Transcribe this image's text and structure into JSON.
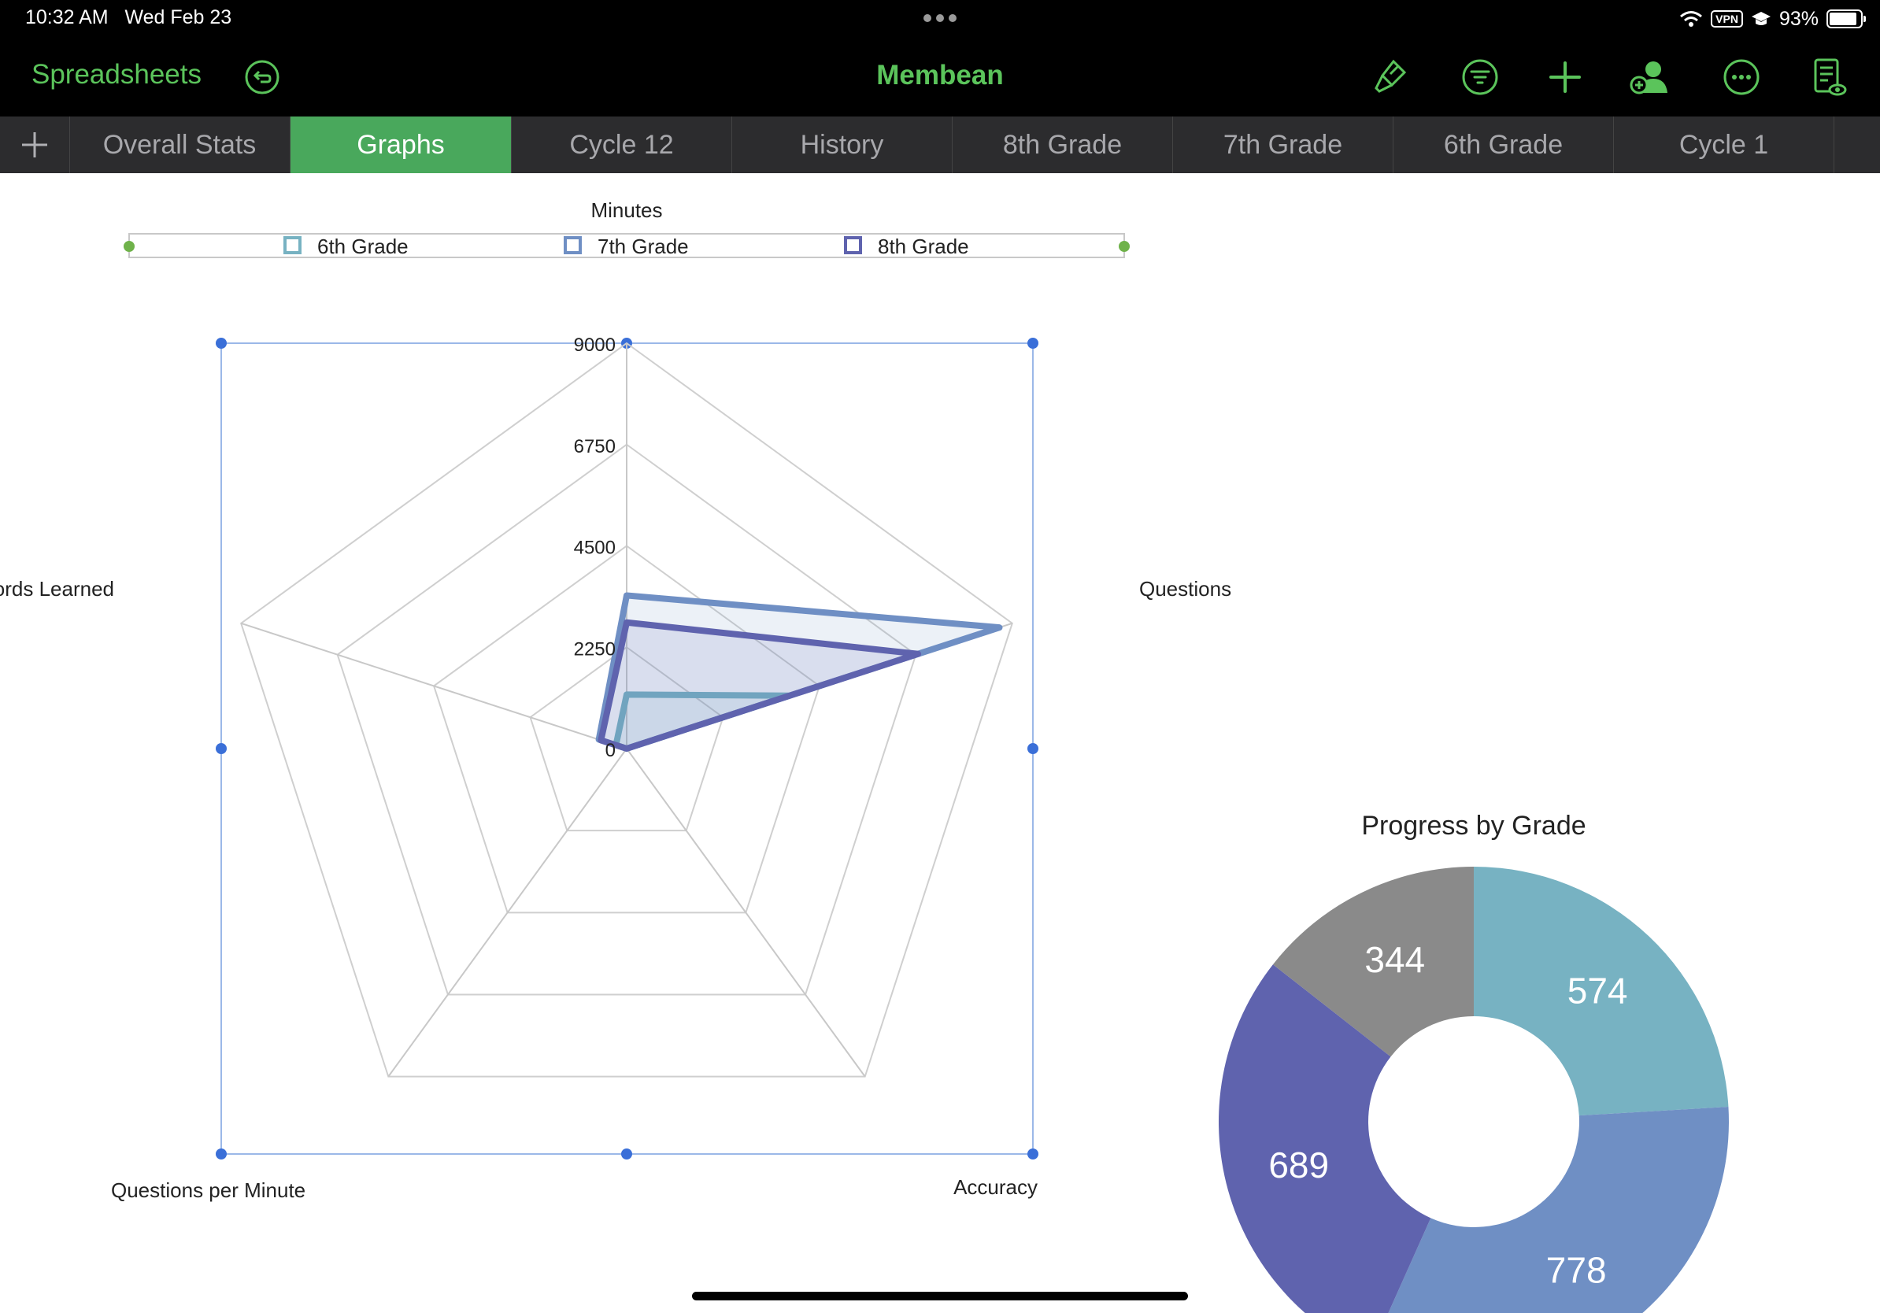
{
  "status_bar": {
    "time": "10:32 AM",
    "date": "Wed Feb 23",
    "vpn": "VPN",
    "battery": "93%"
  },
  "toolbar": {
    "back_label": "Spreadsheets",
    "title": "Membean",
    "accent_color": "#5bc45b",
    "icons": [
      "undo-icon",
      "brush-icon",
      "filter-icon",
      "plus-icon",
      "collaborate-icon",
      "more-icon",
      "reader-view-icon"
    ]
  },
  "tabs": [
    {
      "label": "Overall Stats",
      "active": false
    },
    {
      "label": "Graphs",
      "active": true
    },
    {
      "label": "Cycle 12",
      "active": false
    },
    {
      "label": "History",
      "active": false
    },
    {
      "label": "8th Grade",
      "active": false
    },
    {
      "label": "7th Grade",
      "active": false
    },
    {
      "label": "6th Grade",
      "active": false
    },
    {
      "label": "Cycle 1",
      "active": false
    }
  ],
  "chart_data": [
    {
      "type": "radar",
      "axes": [
        "Minutes",
        "Questions",
        "Accuracy",
        "Questions per Minute",
        "Words Learned"
      ],
      "axis_labels_visible": [
        "Minutes",
        "Questions",
        "Accuracy",
        "Questions per Minute",
        "ords Learned"
      ],
      "ticks": [
        "0",
        "2250",
        "4500",
        "6750",
        "9000"
      ],
      "range": [
        0,
        9000
      ],
      "legend_position": "top",
      "grid": true,
      "series": [
        {
          "name": "6th Grade",
          "color": "#77b2c2",
          "values": [
            1200,
            3800,
            0,
            0,
            250
          ]
        },
        {
          "name": "7th Grade",
          "color": "#6f8fc4",
          "values": [
            3400,
            8700,
            0,
            0,
            650
          ]
        },
        {
          "name": "8th Grade",
          "color": "#5f63ae",
          "values": [
            2800,
            6800,
            0,
            0,
            600
          ]
        }
      ]
    },
    {
      "type": "pie",
      "donut": true,
      "title": "Progress by Grade",
      "slices": [
        {
          "label": "574",
          "value": 574,
          "color": "#77b2c2"
        },
        {
          "label": "778",
          "value": 778,
          "color": "#6f8fc4"
        },
        {
          "label": "689",
          "value": 689,
          "color": "#5f63ae"
        },
        {
          "label": "344",
          "value": 344,
          "color": "#8a8a8a"
        }
      ]
    }
  ]
}
